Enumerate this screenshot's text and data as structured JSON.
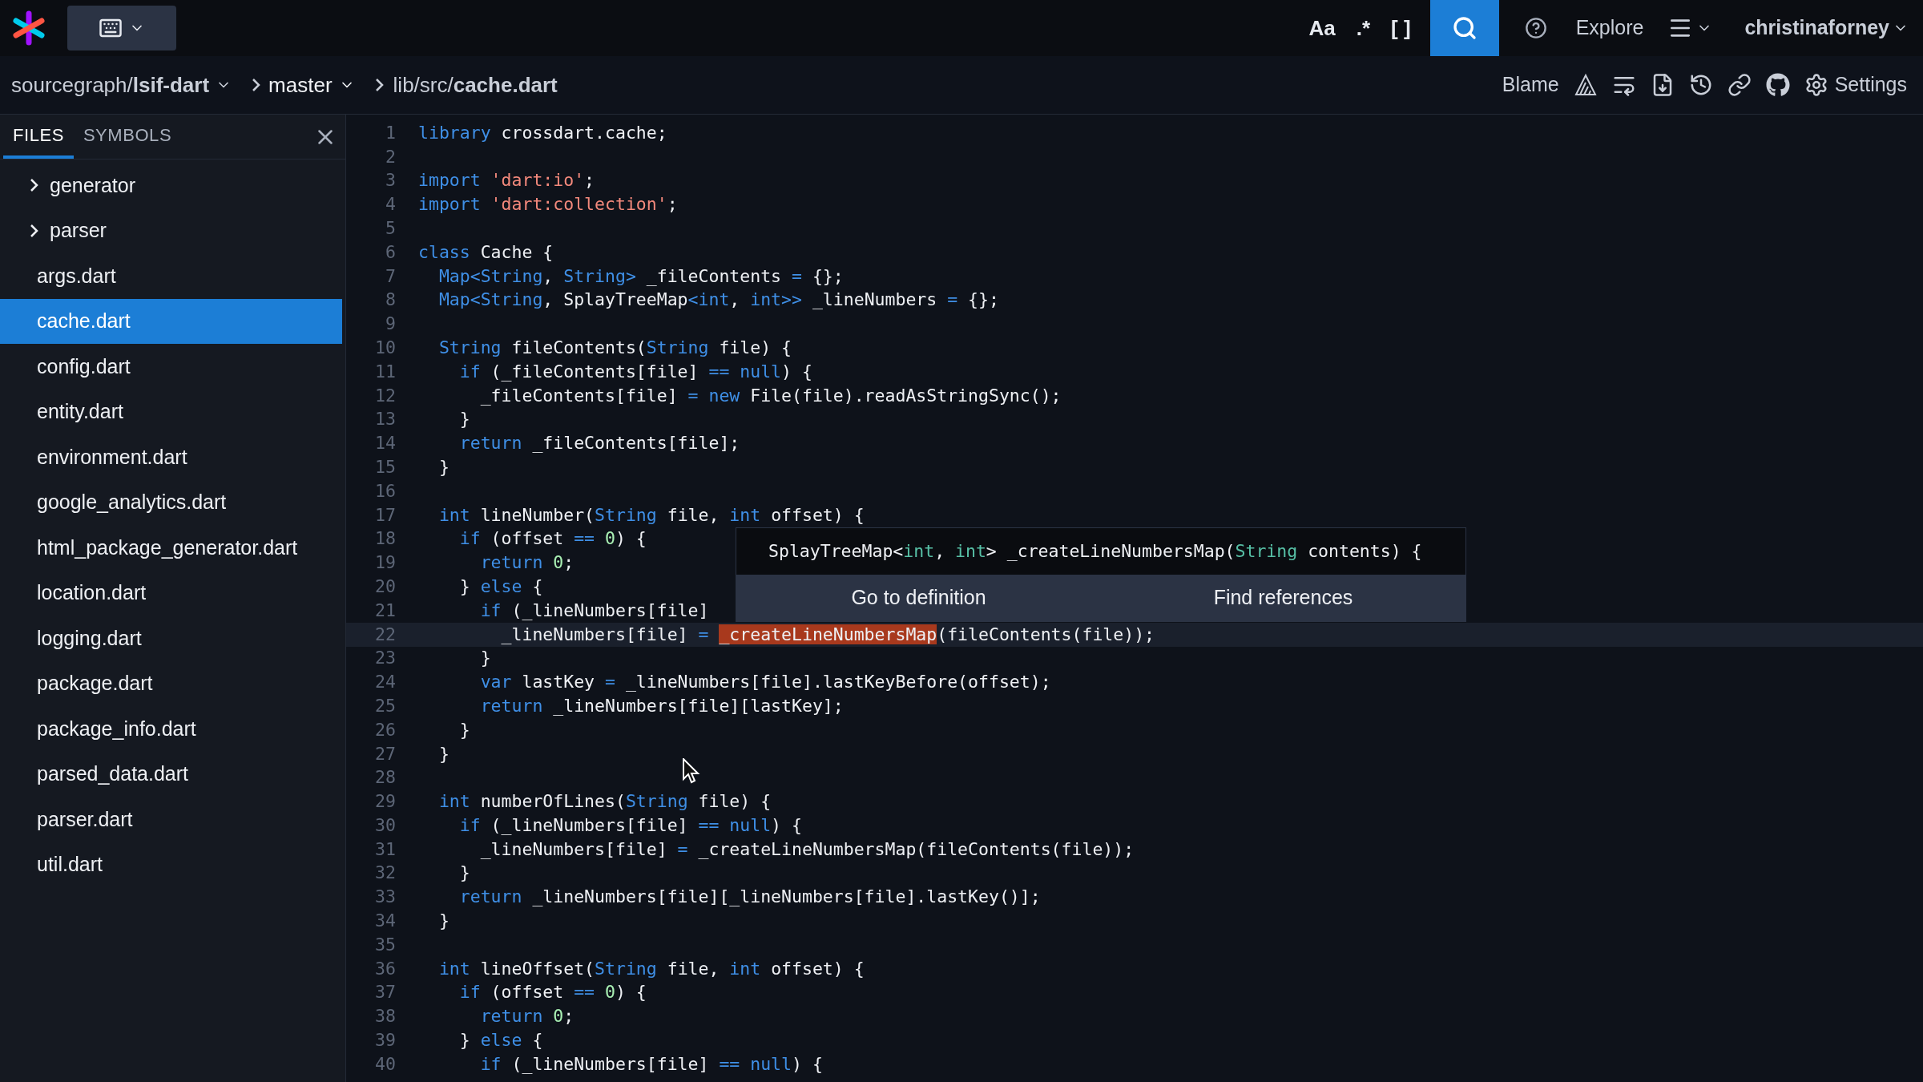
{
  "top_bar": {
    "toggles": [
      {
        "label": "Aa",
        "selected": false
      },
      {
        "label": ".*",
        "selected": false
      },
      {
        "label": "[ ]",
        "selected": false
      }
    ],
    "explore": "Explore",
    "user": "christinaforney"
  },
  "breadcrumb": {
    "repo": "sourcegraph/**lsif-dart**",
    "revision": "master",
    "path": "lib/src/**cache.dart**",
    "actions": {
      "blame": "Blame",
      "settings": "Settings"
    }
  },
  "sidebar": {
    "tabs": [
      {
        "label": "FILES",
        "selected": true
      },
      {
        "label": "SYMBOLS",
        "selected": false
      }
    ],
    "items": [
      {
        "name": "generator",
        "kind": "folder",
        "expanded": false,
        "selected": false
      },
      {
        "name": "parser",
        "kind": "folder",
        "expanded": false,
        "selected": false
      },
      {
        "name": "args.dart",
        "kind": "file",
        "selected": false
      },
      {
        "name": "cache.dart",
        "kind": "file",
        "selected": true
      },
      {
        "name": "config.dart",
        "kind": "file",
        "selected": false
      },
      {
        "name": "entity.dart",
        "kind": "file",
        "selected": false
      },
      {
        "name": "environment.dart",
        "kind": "file",
        "selected": false
      },
      {
        "name": "google_analytics.dart",
        "kind": "file",
        "selected": false
      },
      {
        "name": "html_package_generator.dart",
        "kind": "file",
        "selected": false
      },
      {
        "name": "location.dart",
        "kind": "file",
        "selected": false
      },
      {
        "name": "logging.dart",
        "kind": "file",
        "selected": false
      },
      {
        "name": "package.dart",
        "kind": "file",
        "selected": false
      },
      {
        "name": "package_info.dart",
        "kind": "file",
        "selected": false
      },
      {
        "name": "parsed_data.dart",
        "kind": "file",
        "selected": false
      },
      {
        "name": "parser.dart",
        "kind": "file",
        "selected": false
      },
      {
        "name": "util.dart",
        "kind": "file",
        "selected": false
      }
    ]
  },
  "code": {
    "lines": [
      {
        "number": "1",
        "selected": false,
        "tokens": [
          {
            "text": "library",
            "kind": "keyword"
          },
          {
            "text": " crossdart.cache;",
            "kind": "plain"
          }
        ]
      },
      {
        "number": "2",
        "selected": false
      },
      {
        "number": "3",
        "selected": false,
        "tokens": [
          {
            "text": "import ",
            "kind": "keyword"
          },
          {
            "text": "'dart:io'",
            "kind": "string"
          },
          {
            "text": ";",
            "kind": "plain"
          }
        ]
      },
      {
        "number": "4",
        "selected": false,
        "tokens": [
          {
            "text": "import ",
            "kind": "keyword"
          },
          {
            "text": "'dart:collection'",
            "kind": "string"
          },
          {
            "text": ";",
            "kind": "plain"
          }
        ]
      },
      {
        "number": "5",
        "selected": false
      },
      {
        "number": "6",
        "selected": false,
        "tokens": [
          {
            "text": "class",
            "kind": "keyword"
          },
          {
            "text": " Cache {",
            "kind": "plain"
          }
        ]
      },
      {
        "number": "7",
        "selected": false,
        "tokens": [
          {
            "text": "  Map<String",
            "kind": "keyword"
          },
          {
            "text": ", ",
            "kind": "plain"
          },
          {
            "text": "String>",
            "kind": "keyword"
          },
          {
            "text": " _fileContents ",
            "kind": "plain"
          },
          {
            "text": "=",
            "kind": "keyword"
          },
          {
            "text": " {};",
            "kind": "plain"
          }
        ]
      },
      {
        "number": "8",
        "selected": false,
        "tokens": [
          {
            "text": "  Map<String",
            "kind": "keyword"
          },
          {
            "text": ", SplayTreeMap",
            "kind": "plain"
          },
          {
            "text": "<int",
            "kind": "keyword"
          },
          {
            "text": ", ",
            "kind": "plain"
          },
          {
            "text": "int>>",
            "kind": "keyword"
          },
          {
            "text": " _lineNumbers ",
            "kind": "plain"
          },
          {
            "text": "=",
            "kind": "keyword"
          },
          {
            "text": " {};",
            "kind": "plain"
          }
        ]
      },
      {
        "number": "9",
        "selected": false
      },
      {
        "number": "10",
        "selected": false,
        "tokens": [
          {
            "text": "  String",
            "kind": "keyword"
          },
          {
            "text": " fileContents(",
            "kind": "plain"
          },
          {
            "text": "String",
            "kind": "keyword"
          },
          {
            "text": " file) {",
            "kind": "plain"
          }
        ]
      },
      {
        "number": "11",
        "selected": false,
        "tokens": [
          {
            "text": "    if",
            "kind": "keyword"
          },
          {
            "text": " (_fileContents[file] ",
            "kind": "plain"
          },
          {
            "text": "== null",
            "kind": "keyword"
          },
          {
            "text": ") {",
            "kind": "plain"
          }
        ]
      },
      {
        "number": "12",
        "selected": false,
        "tokens": [
          {
            "text": "      _fileContents[file] ",
            "kind": "plain"
          },
          {
            "text": "= new",
            "kind": "keyword"
          },
          {
            "text": " File(file).readAsStringSync();",
            "kind": "plain"
          }
        ]
      },
      {
        "number": "13",
        "selected": false,
        "tokens": [
          {
            "text": "    }",
            "kind": "plain"
          }
        ]
      },
      {
        "number": "14",
        "selected": false,
        "tokens": [
          {
            "text": "    return",
            "kind": "keyword"
          },
          {
            "text": " _fileContents[file];",
            "kind": "plain"
          }
        ]
      },
      {
        "number": "15",
        "selected": false,
        "tokens": [
          {
            "text": "  }",
            "kind": "plain"
          }
        ]
      },
      {
        "number": "16",
        "selected": false
      },
      {
        "number": "17",
        "selected": false,
        "tokens": [
          {
            "text": "  int",
            "kind": "keyword"
          },
          {
            "text": " lineNumber(",
            "kind": "plain"
          },
          {
            "text": "String",
            "kind": "keyword"
          },
          {
            "text": " file, ",
            "kind": "plain"
          },
          {
            "text": "int",
            "kind": "keyword"
          },
          {
            "text": " offset) {",
            "kind": "plain"
          }
        ]
      },
      {
        "number": "18",
        "selected": false,
        "tokens": [
          {
            "text": "    if",
            "kind": "keyword"
          },
          {
            "text": " (offset ",
            "kind": "plain"
          },
          {
            "text": "== ",
            "kind": "keyword"
          },
          {
            "text": "0",
            "kind": "number"
          },
          {
            "text": ") {",
            "kind": "plain"
          }
        ]
      },
      {
        "number": "19",
        "selected": false,
        "tokens": [
          {
            "text": "      return ",
            "kind": "keyword"
          },
          {
            "text": "0",
            "kind": "number"
          },
          {
            "text": ";",
            "kind": "plain"
          }
        ]
      },
      {
        "number": "20",
        "selected": false,
        "tokens": [
          {
            "text": "    } ",
            "kind": "plain"
          },
          {
            "text": "else",
            "kind": "keyword"
          },
          {
            "text": " {",
            "kind": "plain"
          }
        ]
      },
      {
        "number": "21",
        "selected": false,
        "tokens": [
          {
            "text": "      if",
            "kind": "keyword"
          },
          {
            "text": " (_lineNumbers[file]",
            "kind": "plain"
          }
        ]
      },
      {
        "number": "22",
        "selected": true,
        "tokens": [
          {
            "text": "        _lineNumbers[file] ",
            "kind": "plain"
          },
          {
            "text": "= ",
            "kind": "keyword"
          },
          {
            "text": "_createLineNumbersMap",
            "kind": "match"
          },
          {
            "text": "(fileContents(file));",
            "kind": "plain"
          }
        ]
      },
      {
        "number": "23",
        "selected": false,
        "tokens": [
          {
            "text": "      }",
            "kind": "plain"
          }
        ]
      },
      {
        "number": "24",
        "selected": false,
        "tokens": [
          {
            "text": "      var",
            "kind": "keyword"
          },
          {
            "text": " lastKey ",
            "kind": "plain"
          },
          {
            "text": "=",
            "kind": "keyword"
          },
          {
            "text": " _lineNumbers[file].lastKeyBefore(offset);",
            "kind": "plain"
          }
        ]
      },
      {
        "number": "25",
        "selected": false,
        "tokens": [
          {
            "text": "      return",
            "kind": "keyword"
          },
          {
            "text": " _lineNumbers[file][lastKey];",
            "kind": "plain"
          }
        ]
      },
      {
        "number": "26",
        "selected": false,
        "tokens": [
          {
            "text": "    }",
            "kind": "plain"
          }
        ]
      },
      {
        "number": "27",
        "selected": false,
        "tokens": [
          {
            "text": "  }",
            "kind": "plain"
          }
        ]
      },
      {
        "number": "28",
        "selected": false
      },
      {
        "number": "29",
        "selected": false,
        "tokens": [
          {
            "text": "  int",
            "kind": "keyword"
          },
          {
            "text": " numberOfLines(",
            "kind": "plain"
          },
          {
            "text": "String",
            "kind": "keyword"
          },
          {
            "text": " file) {",
            "kind": "plain"
          }
        ]
      },
      {
        "number": "30",
        "selected": false,
        "tokens": [
          {
            "text": "    if",
            "kind": "keyword"
          },
          {
            "text": " (_lineNumbers[file] ",
            "kind": "plain"
          },
          {
            "text": "== null",
            "kind": "keyword"
          },
          {
            "text": ") {",
            "kind": "plain"
          }
        ]
      },
      {
        "number": "31",
        "selected": false,
        "tokens": [
          {
            "text": "      _lineNumbers[file] ",
            "kind": "plain"
          },
          {
            "text": "=",
            "kind": "keyword"
          },
          {
            "text": " _createLineNumbersMap(fileContents(file));",
            "kind": "plain"
          }
        ]
      },
      {
        "number": "32",
        "selected": false,
        "tokens": [
          {
            "text": "    }",
            "kind": "plain"
          }
        ]
      },
      {
        "number": "33",
        "selected": false,
        "tokens": [
          {
            "text": "    return",
            "kind": "keyword"
          },
          {
            "text": " _lineNumbers[file][_lineNumbers[file].lastKey()];",
            "kind": "plain"
          }
        ]
      },
      {
        "number": "34",
        "selected": false,
        "tokens": [
          {
            "text": "  }",
            "kind": "plain"
          }
        ]
      },
      {
        "number": "35",
        "selected": false
      },
      {
        "number": "36",
        "selected": false,
        "tokens": [
          {
            "text": "  int",
            "kind": "keyword"
          },
          {
            "text": " lineOffset(",
            "kind": "plain"
          },
          {
            "text": "String",
            "kind": "keyword"
          },
          {
            "text": " file, ",
            "kind": "plain"
          },
          {
            "text": "int",
            "kind": "keyword"
          },
          {
            "text": " offset) {",
            "kind": "plain"
          }
        ]
      },
      {
        "number": "37",
        "selected": false,
        "tokens": [
          {
            "text": "    if",
            "kind": "keyword"
          },
          {
            "text": " (offset ",
            "kind": "plain"
          },
          {
            "text": "== ",
            "kind": "keyword"
          },
          {
            "text": "0",
            "kind": "number"
          },
          {
            "text": ") {",
            "kind": "plain"
          }
        ]
      },
      {
        "number": "38",
        "selected": false,
        "tokens": [
          {
            "text": "      return ",
            "kind": "keyword"
          },
          {
            "text": "0",
            "kind": "number"
          },
          {
            "text": ";",
            "kind": "plain"
          }
        ]
      },
      {
        "number": "39",
        "selected": false,
        "tokens": [
          {
            "text": "    } ",
            "kind": "plain"
          },
          {
            "text": "else",
            "kind": "keyword"
          },
          {
            "text": " {",
            "kind": "plain"
          }
        ]
      },
      {
        "number": "40",
        "selected": false,
        "tokens": [
          {
            "text": "      if",
            "kind": "keyword"
          },
          {
            "text": " (_lineNumbers[file] ",
            "kind": "plain"
          },
          {
            "text": "== null",
            "kind": "keyword"
          },
          {
            "text": ") {",
            "kind": "plain"
          }
        ]
      }
    ],
    "hover_tooltip": {
      "signature": [
        {
          "text": "SplayTreeMap<",
          "kind": "plain"
        },
        {
          "text": "int",
          "kind": "type"
        },
        {
          "text": ", ",
          "kind": "plain"
        },
        {
          "text": "int",
          "kind": "type"
        },
        {
          "text": "> _createLineNumbersMap(",
          "kind": "plain"
        },
        {
          "text": "String",
          "kind": "type"
        },
        {
          "text": " contents) {",
          "kind": "plain"
        }
      ],
      "actions": [
        "Go to definition",
        "Find references"
      ]
    }
  }
}
